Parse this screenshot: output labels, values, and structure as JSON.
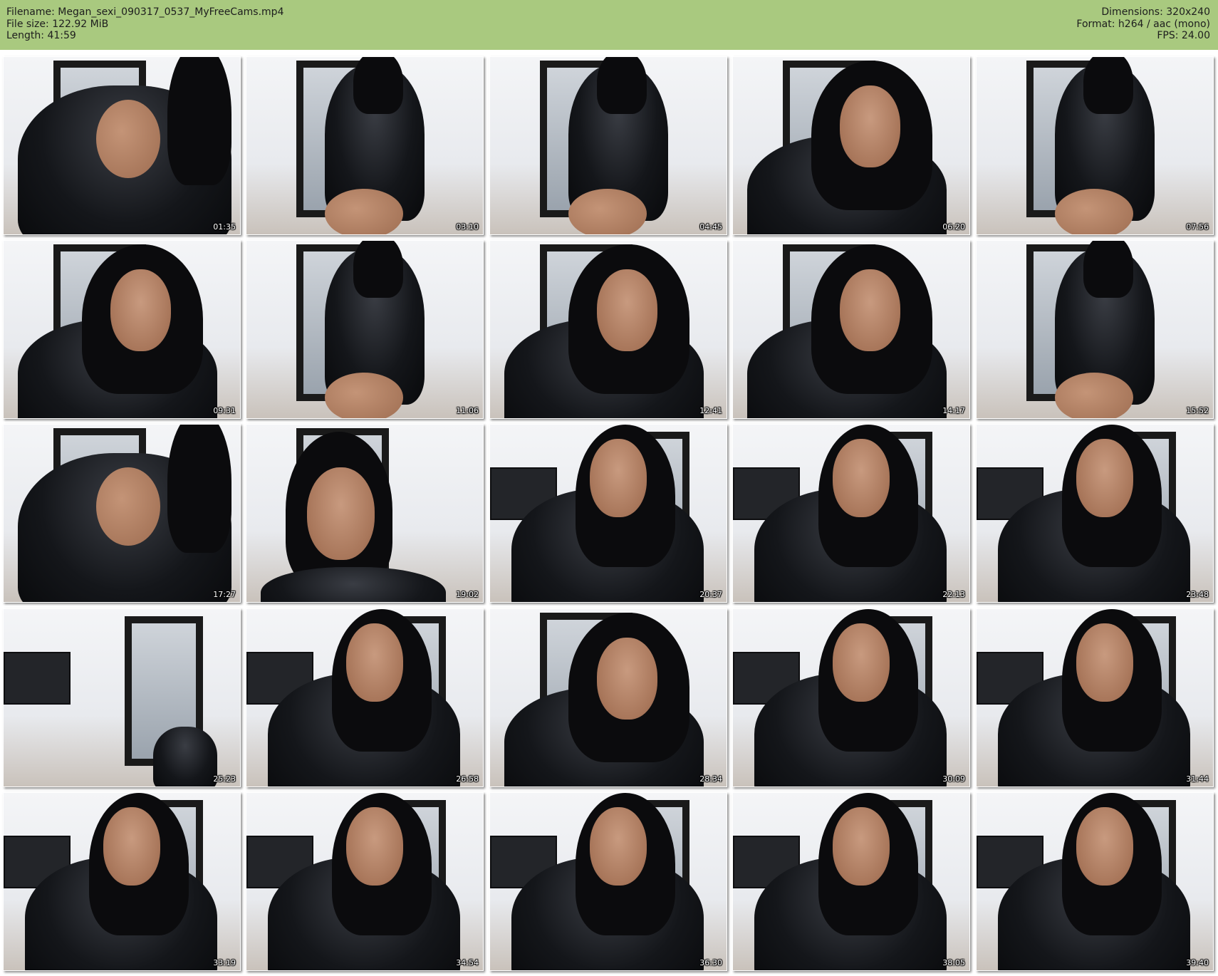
{
  "header": {
    "filename_label": "Filename: Megan_sexi_090317_0537_MyFreeCams.mp4",
    "filesize_label": "File size: 122.92 MiB",
    "length_label": "Length: 41:59",
    "dimensions_label": "Dimensions: 320x240",
    "format_label": "Format: h264 / aac (mono)",
    "fps_label": "FPS: 24.00",
    "background_color": "#a9c97f"
  },
  "thumbnails": [
    {
      "time": "01:35",
      "scene": "closeup-torso"
    },
    {
      "time": "03:10",
      "scene": "back-view"
    },
    {
      "time": "04:45",
      "scene": "back-view"
    },
    {
      "time": "06:20",
      "scene": "face-leaning"
    },
    {
      "time": "07:56",
      "scene": "back-view"
    },
    {
      "time": "09:31",
      "scene": "face-leaning"
    },
    {
      "time": "11:06",
      "scene": "back-view"
    },
    {
      "time": "12:41",
      "scene": "face-leaning"
    },
    {
      "time": "14:17",
      "scene": "face-leaning"
    },
    {
      "time": "15:52",
      "scene": "back-view"
    },
    {
      "time": "17:27",
      "scene": "closeup-torso"
    },
    {
      "time": "19:02",
      "scene": "face-closeup"
    },
    {
      "time": "20:37",
      "scene": "tv-room"
    },
    {
      "time": "22:13",
      "scene": "tv-room"
    },
    {
      "time": "23:48",
      "scene": "tv-room"
    },
    {
      "time": "25:23",
      "scene": "empty-room"
    },
    {
      "time": "26:58",
      "scene": "tv-room"
    },
    {
      "time": "28:34",
      "scene": "face-leaning"
    },
    {
      "time": "30:09",
      "scene": "tv-room"
    },
    {
      "time": "31:44",
      "scene": "tv-room"
    },
    {
      "time": "33:19",
      "scene": "tv-room"
    },
    {
      "time": "34:54",
      "scene": "tv-room"
    },
    {
      "time": "36:30",
      "scene": "tv-room"
    },
    {
      "time": "38:05",
      "scene": "tv-room"
    },
    {
      "time": "39:40",
      "scene": "tv-room"
    }
  ]
}
